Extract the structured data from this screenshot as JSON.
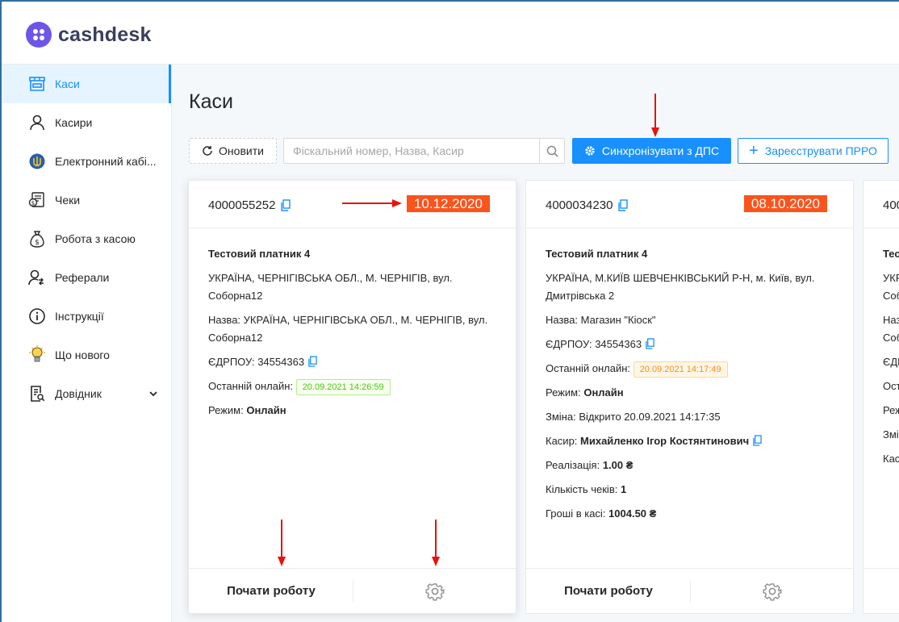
{
  "app": {
    "logo_text": "cashdesk"
  },
  "sidebar": {
    "items": [
      {
        "label": "Каси",
        "icon": "store-icon",
        "active": true
      },
      {
        "label": "Касири",
        "icon": "user-icon"
      },
      {
        "label": "Електронний кабі...",
        "icon": "trident-icon"
      },
      {
        "label": "Чеки",
        "icon": "receipt-icon"
      },
      {
        "label": "Робота з касою",
        "icon": "money-bag-icon"
      },
      {
        "label": "Реферали",
        "icon": "referral-icon"
      },
      {
        "label": "Інструкції",
        "icon": "info-icon"
      },
      {
        "label": "Що нового",
        "icon": "lightbulb-icon"
      },
      {
        "label": "Довідник",
        "icon": "reference-icon",
        "has_chevron": true
      }
    ]
  },
  "page": {
    "title": "Каси"
  },
  "toolbar": {
    "refresh_label": "Оновити",
    "search_placeholder": "Фіскальний номер, Назва, Касир",
    "sync_label": "Синхронізувати з ДПС",
    "register_label": "Зареєструвати ПРРО"
  },
  "cards": [
    {
      "fiscal_number": "4000055252",
      "date": "10.12.2020",
      "payer": "Тестовий платник 4",
      "address": "УКРАЇНА, ЧЕРНІГІВСЬКА ОБЛ., М. ЧЕРНІГІВ, вул. Соборна12",
      "name_label": "Назва:",
      "name_value": "УКРАЇНА, ЧЕРНІГІВСЬКА ОБЛ., М. ЧЕРНІГІВ, вул. Соборна12",
      "edrpou_label": "ЄДРПОУ:",
      "edrpou_value": "34554363",
      "last_online_label": "Останній онлайн:",
      "last_online_value": "20.09.2021 14:26:59",
      "mode_label": "Режим:",
      "mode_value": "Онлайн",
      "start_label": "Почати роботу"
    },
    {
      "fiscal_number": "4000034230",
      "date": "08.10.2020",
      "payer": "Тестовий платник 4",
      "address": "УКРАЇНА, М.КИЇВ ШЕВЧЕНКІВСЬКИЙ Р-Н, м. Київ, вул. Дмитрівська 2",
      "name_label": "Назва:",
      "name_value": "Магазин \"Кіоск\"",
      "edrpou_label": "ЄДРПОУ:",
      "edrpou_value": "34554363",
      "last_online_label": "Останній онлайн:",
      "last_online_value": "20.09.2021 14:17:49",
      "mode_label": "Режим:",
      "mode_value": "Онлайн",
      "shift_label": "Зміна:",
      "shift_value": "Відкрито 20.09.2021 14:17:35",
      "cashier_label": "Касир:",
      "cashier_value": "Михайленко Ігор Костянтинович",
      "sales_label": "Реалізація:",
      "sales_value": "1.00 ₴",
      "receipts_label": "Кількість чеків:",
      "receipts_value": "1",
      "cash_label": "Гроші в касі:",
      "cash_value": "1004.50 ₴",
      "start_label": "Почати роботу"
    },
    {
      "fiscal_number": "400",
      "payer": "Тес",
      "address": "УКР",
      "address2": "Соб",
      "name_label": "Наз",
      "name2": "Соб",
      "edrpou_label": "ЄДР",
      "last_online_label": "Ост",
      "mode_label": "Реж",
      "shift_label": "Змі",
      "cashier_label": "Кас"
    }
  ],
  "colors": {
    "primary": "#1890ff",
    "date_badge": "#fa541c",
    "online_green": "#52c41a",
    "online_orange": "#fa8c16",
    "annotation_arrow": "#e8120c",
    "logo": "#6d55e8"
  }
}
